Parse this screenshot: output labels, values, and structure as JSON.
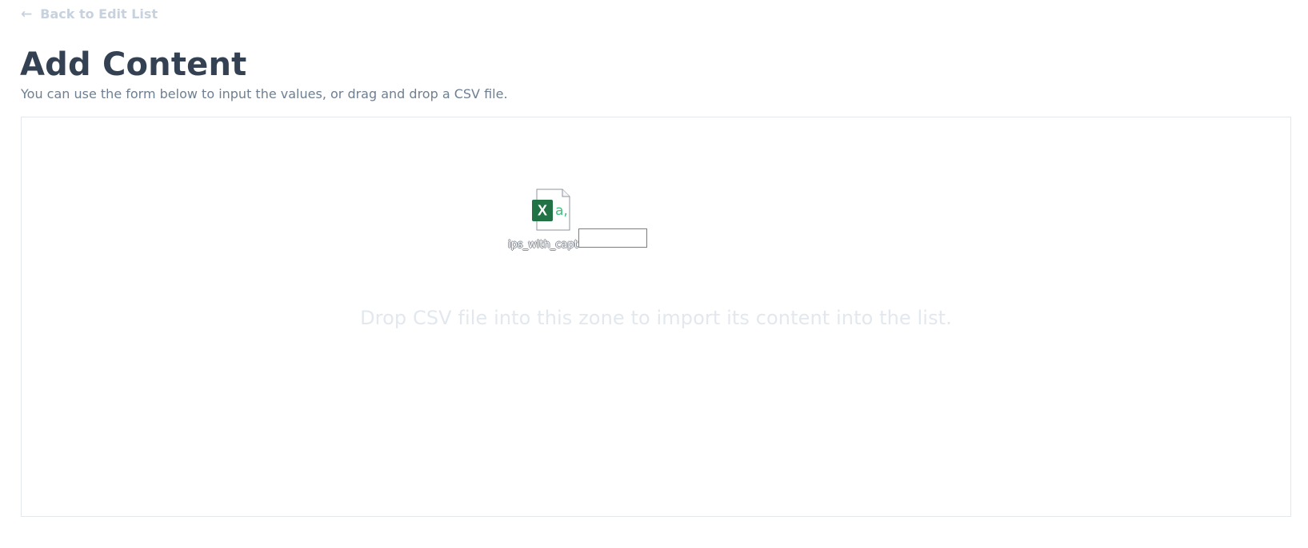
{
  "navigation": {
    "back_arrow_icon": "left-arrow-icon",
    "back_label": "Back to Edit List"
  },
  "header": {
    "title": "Add Content",
    "subtitle": "You can use the form below to input the values, or drag and drop a CSV file."
  },
  "drop_zone": {
    "message": "Drop CSV file into this zone to import its content into the list."
  },
  "dragged_file": {
    "icon": "excel-csv-file-icon",
    "name": "ips_with_capt"
  },
  "colors": {
    "title": "#334152",
    "subtitle": "#6e7f91",
    "back_link": "#c7d2de",
    "drop_border": "#e2e8ee",
    "drop_message": "#e3e8ee",
    "excel_green": "#217346",
    "csv_green": "#3cc27b"
  }
}
